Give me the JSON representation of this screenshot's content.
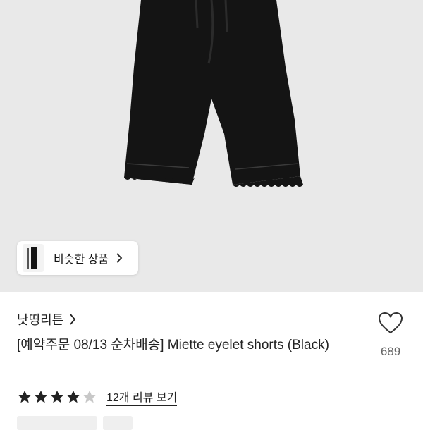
{
  "hero": {
    "similar_button_label": "비슷한 상품"
  },
  "product": {
    "store_name": "낫띵리튼",
    "title": "[예약주문 08/13 순차배송] Miette eyelet shorts (Black)",
    "like_count": "689",
    "rating": 4,
    "rating_max": 5,
    "review_link": "12개 리뷰 보기",
    "tags": [
      "",
      ""
    ]
  },
  "icons": {
    "like": "heart-outline-icon",
    "store_chevron": "chevron-right-icon",
    "similar_chevron": "chevron-right-icon",
    "star_filled": "star-filled-icon",
    "star_empty": "star-empty-icon"
  },
  "colors": {
    "hero_bg": "#e9e9e9",
    "star_filled": "#222222",
    "star_empty": "#c8c8c8",
    "like_count": "#666666"
  }
}
